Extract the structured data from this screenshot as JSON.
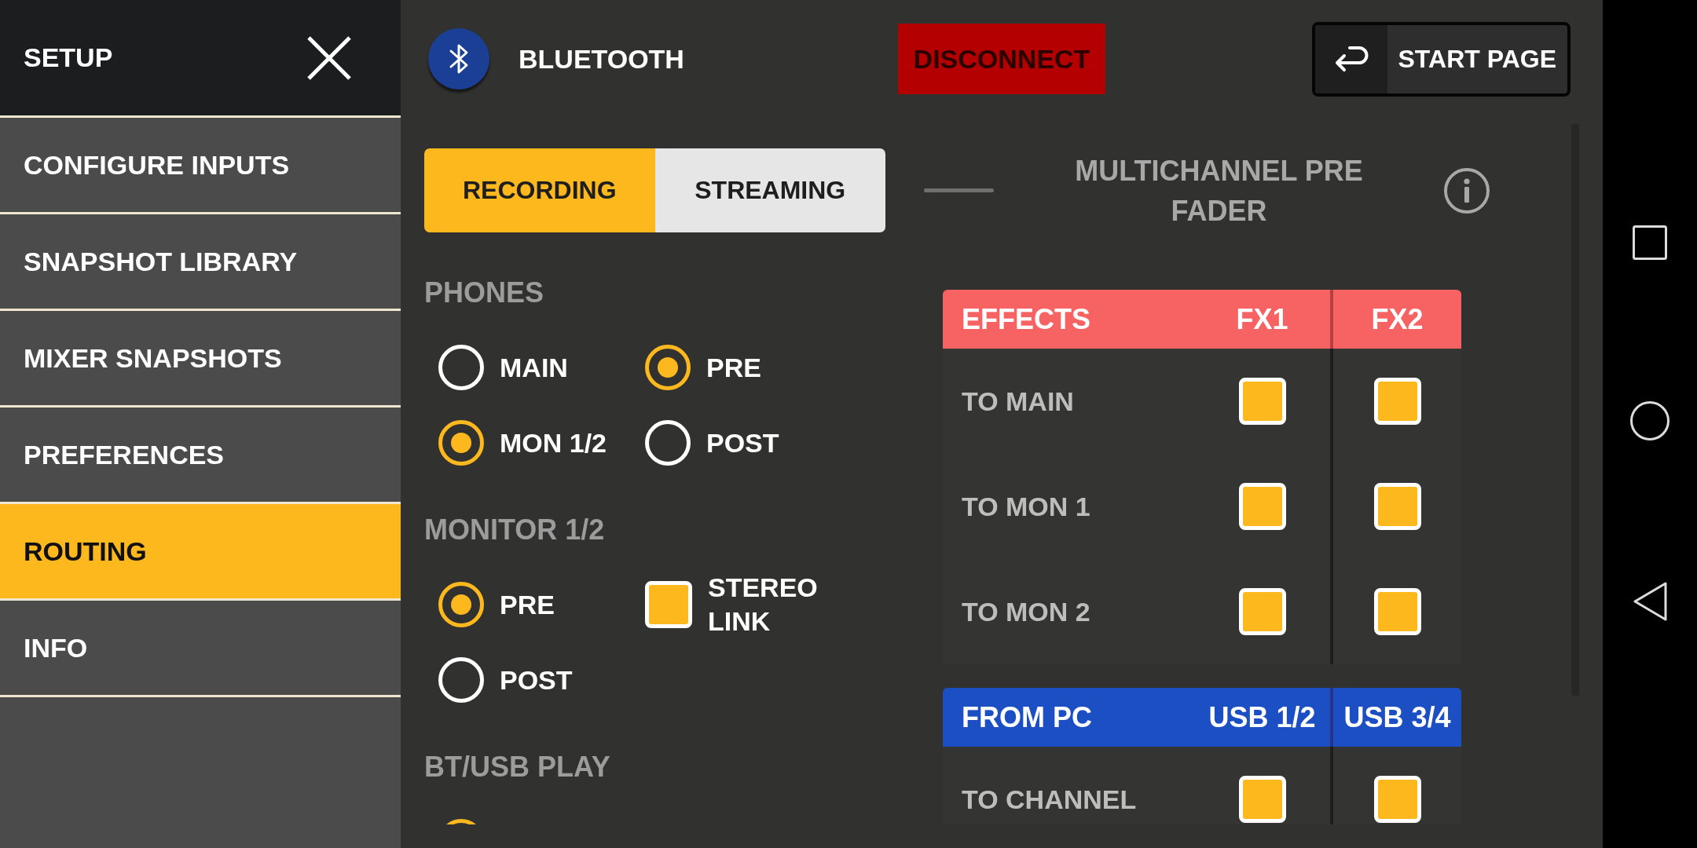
{
  "sidebar": {
    "title": "SETUP",
    "items": [
      {
        "label": "CONFIGURE INPUTS",
        "selected": false
      },
      {
        "label": "SNAPSHOT LIBRARY",
        "selected": false
      },
      {
        "label": "MIXER SNAPSHOTS",
        "selected": false
      },
      {
        "label": "PREFERENCES",
        "selected": false
      },
      {
        "label": "ROUTING",
        "selected": true
      },
      {
        "label": "INFO",
        "selected": false
      }
    ]
  },
  "header": {
    "title": "BLUETOOTH",
    "disconnect_button": "DISCONNECT",
    "start_page_button": "START PAGE"
  },
  "tabs": [
    {
      "label": "RECORDING",
      "selected": true
    },
    {
      "label": "STREAMING",
      "selected": false
    }
  ],
  "sections": [
    {
      "title": "PHONES",
      "options": [
        {
          "kind": "radio",
          "label": "MAIN",
          "selected": false
        },
        {
          "kind": "radio",
          "label": "PRE",
          "selected": true
        },
        {
          "kind": "radio",
          "label": "MON 1/2",
          "selected": true
        },
        {
          "kind": "radio",
          "label": "POST",
          "selected": false
        }
      ]
    },
    {
      "title": "MONITOR 1/2",
      "options": [
        {
          "kind": "radio",
          "label": "PRE",
          "selected": true
        },
        {
          "kind": "checkbox",
          "label": "STEREO LINK",
          "checked": true
        },
        {
          "kind": "radio",
          "label": "POST",
          "selected": false
        }
      ]
    },
    {
      "title": "BT/USB PLAY",
      "options": [
        {
          "kind": "radio",
          "selected": true
        }
      ]
    }
  ],
  "panel": {
    "title": "MULTICHANNEL PRE FADER",
    "tables": [
      {
        "title": "EFFECTS",
        "color": "#f76262",
        "columns": [
          "FX1",
          "FX2"
        ],
        "rows": [
          {
            "label": "TO MAIN",
            "checked": [
              true,
              true
            ]
          },
          {
            "label": "TO MON 1",
            "checked": [
              true,
              true
            ]
          },
          {
            "label": "TO MON 2",
            "checked": [
              true,
              true
            ]
          }
        ]
      },
      {
        "title": "FROM PC",
        "color": "#1c4fc4",
        "columns": [
          "USB 1/2",
          "USB 3/4"
        ],
        "rows": [
          {
            "label": "TO CHANNEL",
            "checked": [
              true,
              true
            ]
          }
        ]
      }
    ]
  }
}
